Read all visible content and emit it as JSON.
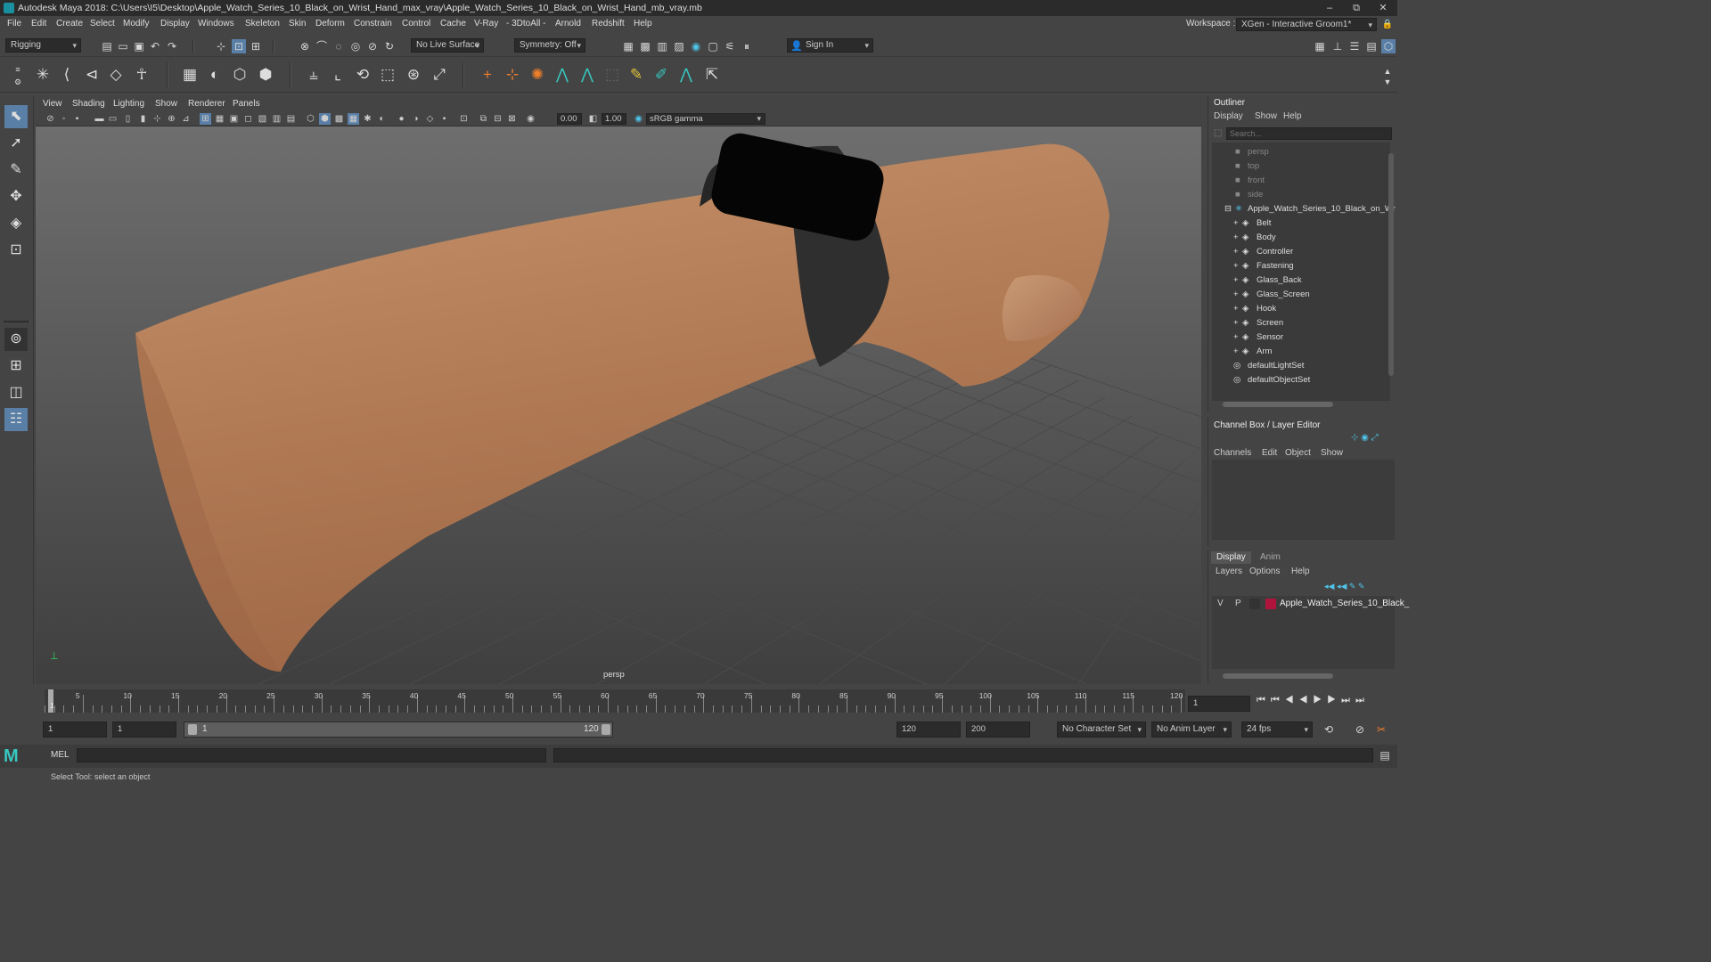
{
  "window": {
    "title": "Autodesk Maya 2018: C:\\Users\\I5\\Desktop\\Apple_Watch_Series_10_Black_on_Wrist_Hand_max_vray\\Apple_Watch_Series_10_Black_on_Wrist_Hand_mb_vray.mb",
    "minimize": "–",
    "restore": "⧉",
    "close": "✕"
  },
  "menubar": {
    "items": [
      "File",
      "Edit",
      "Create",
      "Select",
      "Modify",
      "Display",
      "Windows",
      "Skeleton",
      "Skin",
      "Deform",
      "Constrain",
      "Control",
      "Cache",
      "V-Ray",
      "- 3DtoAll -",
      "Arnold",
      "Redshift",
      "Help"
    ],
    "workspace_label": "Workspace :",
    "workspace_value": "XGen - Interactive Groom1*"
  },
  "statusline": {
    "menuset": "Rigging",
    "live_surface": "No Live Surface",
    "symmetry": "Symmetry: Off",
    "sign_in": "Sign In"
  },
  "panel": {
    "menus": [
      "View",
      "Shading",
      "Lighting",
      "Show",
      "Renderer",
      "Panels"
    ],
    "exposure": "0.00",
    "gamma": "1.00",
    "color_space": "sRGB gamma",
    "camera_label": "persp"
  },
  "outliner": {
    "title": "Outliner",
    "menus": [
      "Display",
      "Show",
      "Help"
    ],
    "search_placeholder": "Search...",
    "cameras": [
      "persp",
      "top",
      "front",
      "side"
    ],
    "group": "Apple_Watch_Series_10_Black_on_Wr",
    "children": [
      "Belt",
      "Body",
      "Controller",
      "Fastening",
      "Glass_Back",
      "Glass_Screen",
      "Hook",
      "Screen",
      "Sensor",
      "Arm"
    ],
    "sets": [
      "defaultLightSet",
      "defaultObjectSet"
    ]
  },
  "channelbox": {
    "title": "Channel Box / Layer Editor",
    "menus": [
      "Channels",
      "Edit",
      "Object",
      "Show"
    ]
  },
  "layers": {
    "tabs": [
      "Display",
      "Anim"
    ],
    "menus": [
      "Layers",
      "Options",
      "Help"
    ],
    "layer_v": "V",
    "layer_p": "P",
    "layer_name": "Apple_Watch_Series_10_Black_",
    "layer_color": "#b0143c"
  },
  "timeline": {
    "ticks": [
      "5",
      "10",
      "15",
      "20",
      "25",
      "30",
      "35",
      "40",
      "45",
      "50",
      "55",
      "60",
      "65",
      "70",
      "75",
      "80",
      "85",
      "90",
      "95",
      "100",
      "105",
      "110",
      "115",
      "120"
    ],
    "current_frame_marker": "1",
    "current_frame": "1"
  },
  "range": {
    "start": "1",
    "playback_start": "1",
    "slider_start": "1",
    "slider_end": "120",
    "playback_end": "120",
    "end": "200",
    "character_set": "No Character Set",
    "anim_layer": "No Anim Layer",
    "fps": "24 fps"
  },
  "commandline": {
    "lang": "MEL"
  },
  "helpline": {
    "text": "Select Tool: select an object"
  }
}
